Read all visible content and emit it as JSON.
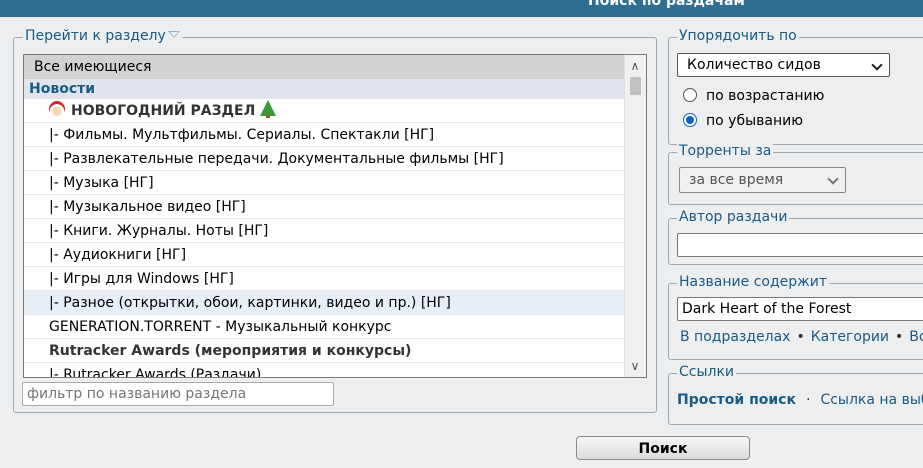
{
  "header": {
    "title": "Поиск по раздачам"
  },
  "sections": {
    "legend": "Перейти к разделу",
    "items": [
      {
        "label": "Все имеющиеся",
        "kind": "all"
      },
      {
        "label": "Новости",
        "kind": "group"
      },
      {
        "label": "НОВОГОДНИЙ РАЗДЕЛ",
        "kind": "root-xmas"
      },
      {
        "label": "|- Фильмы. Мультфильмы. Сериалы. Спектакли [НГ]",
        "kind": "sub"
      },
      {
        "label": "|- Развлекательные передачи. Документальные фильмы [НГ]",
        "kind": "sub"
      },
      {
        "label": "|- Музыка [НГ]",
        "kind": "sub"
      },
      {
        "label": "|- Музыкальное видео [НГ]",
        "kind": "sub"
      },
      {
        "label": "|- Книги. Журналы. Ноты [НГ]",
        "kind": "sub"
      },
      {
        "label": "|- Аудиокниги [НГ]",
        "kind": "sub"
      },
      {
        "label": "|- Игры для Windows [НГ]",
        "kind": "sub"
      },
      {
        "label": "|- Разное (открытки, обои, картинки, видео и пр.) [НГ]",
        "kind": "sub-hl"
      },
      {
        "label": "GENERATION.TORRENT - Музыкальный конкурс",
        "kind": "plain"
      },
      {
        "label": "Rutracker Awards (мероприятия и конкурсы)",
        "kind": "root"
      },
      {
        "label": "|- Rutracker Awards (Раздачи)",
        "kind": "sub"
      }
    ],
    "filter_placeholder": "фильтр по названию раздела"
  },
  "sort": {
    "legend": "Упорядочить по",
    "selected": "Количество сидов",
    "asc_label": "по возрастанию",
    "desc_label": "по убыванию",
    "direction": "desc"
  },
  "period": {
    "legend": "Торренты за",
    "selected": "за все время"
  },
  "author": {
    "legend": "Автор раздачи",
    "value": ""
  },
  "title_contains": {
    "legend": "Название содержит",
    "value": "Dark Heart of the Forest",
    "in_subsections": "В подразделах",
    "categories": "Категории",
    "all": "Все"
  },
  "links": {
    "legend": "Ссылки",
    "simple_search": "Простой поиск",
    "search_link": "Ссылка на выб"
  },
  "search_button": "Поиск"
}
